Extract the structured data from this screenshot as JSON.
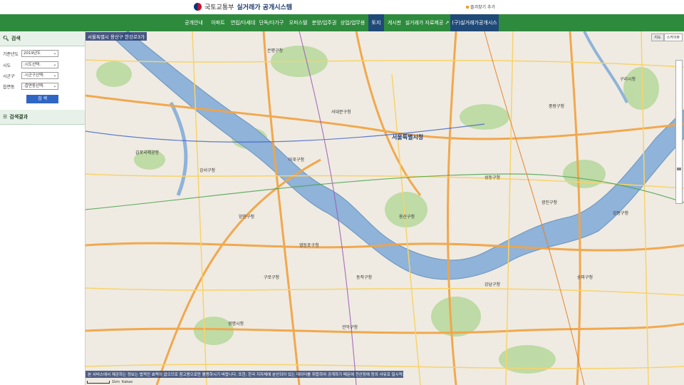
{
  "header": {
    "ministry": "국토교통부",
    "system_title": "실거래가 공개시스템",
    "favorites": "즐겨찾기 추가"
  },
  "nav": {
    "items": [
      {
        "label": "공개안내"
      },
      {
        "label": "아파트"
      },
      {
        "label": "연립/다세대"
      },
      {
        "label": "단독/다가구"
      },
      {
        "label": "오피스텔"
      },
      {
        "label": "분양/입주권"
      },
      {
        "label": "상업/업무용"
      },
      {
        "label": "토지"
      },
      {
        "label": "게시판"
      },
      {
        "label": "실거래가 자료제공"
      },
      {
        "label": "(구)실거래가공개시스템"
      }
    ],
    "active_index": 7
  },
  "sidebar": {
    "search_title": "검색",
    "fields": [
      {
        "label": "기준년도",
        "value": "2019년도"
      },
      {
        "label": "시도",
        "value": ":시도선택:"
      },
      {
        "label": "시군구",
        "value": ":시군구선택:"
      },
      {
        "label": "읍면동",
        "value": ":읍면동선택:"
      }
    ],
    "search_button": "검 색",
    "results_title": "검색결과"
  },
  "map": {
    "location": "서울특별시 용산구 한강로3가",
    "map_types": [
      "지도",
      "스카이뷰"
    ],
    "disclaimer": "본 서비스에서 제공하는 정보는 법적인 효력이 없으므로 참고용으로만 활용하시기 바랍니다. 또한, 한국 지자체에 분산되어 있는 데이터를 취합하여 공개하기 때문에 전산장애 등의 사유로 일시적으로 공개되지 않을 수도 있습니다.",
    "scale": "1km",
    "attribution": "Kakao",
    "labels": {
      "city_hall": "서울특별시청",
      "gangseo": "강서구청",
      "yangcheon": "양천구청",
      "guro": "구로구청",
      "gwangmyeong": "광명시청",
      "guri": "구리시청",
      "gimpo_airport": "김포국제공항",
      "seodaemun": "서대문구청",
      "yongsan": "용산구청",
      "gangdong": "강동구청",
      "songpa": "송파구청",
      "gangnam": "강남구청",
      "mapo": "마포구청",
      "gwanak": "관악구청",
      "dongjak": "동작구청",
      "seongdong": "성동구청",
      "jungnang": "중랑구청",
      "gwangjin": "광진구청",
      "yeongdeungpo": "영등포구청",
      "eunpyeong": "은평구청"
    }
  }
}
